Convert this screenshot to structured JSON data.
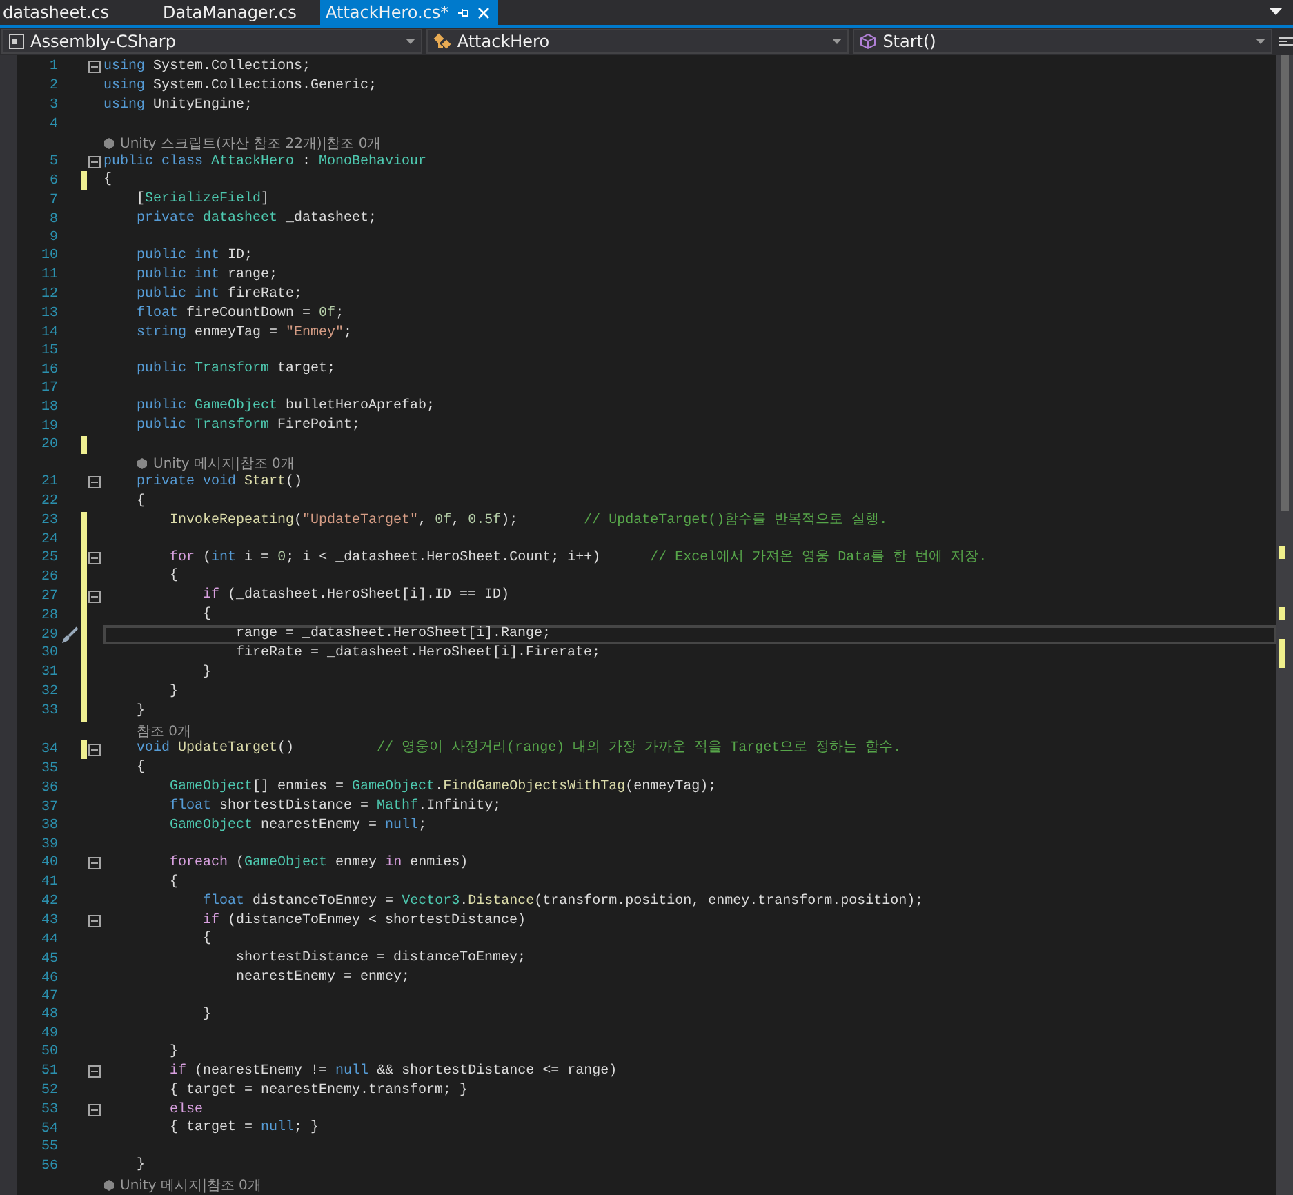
{
  "tabs": [
    {
      "label": "datasheet.cs",
      "selected": false
    },
    {
      "label": "DataManager.cs",
      "selected": false
    },
    {
      "label": "AttackHero.cs*",
      "selected": true
    }
  ],
  "navigation_bar": [
    {
      "kind": "project",
      "text": "Assembly-CSharp"
    },
    {
      "kind": "class",
      "text": "AttackHero"
    },
    {
      "kind": "member",
      "text": "Start()"
    }
  ],
  "editor": {
    "lines": [
      {
        "kind": "code",
        "number": "1",
        "fold": true,
        "changed": false,
        "current": false,
        "tokens": [
          {
            "kind": "kw",
            "text": "using"
          },
          {
            "kind": "p",
            "text": " System.Collections;"
          }
        ]
      },
      {
        "kind": "code",
        "number": "2",
        "fold": false,
        "changed": false,
        "current": false,
        "tokens": [
          {
            "kind": "kw",
            "text": "using"
          },
          {
            "kind": "p",
            "text": " System.Collections.Generic;"
          }
        ]
      },
      {
        "kind": "code",
        "number": "3",
        "fold": false,
        "changed": false,
        "current": false,
        "tokens": [
          {
            "kind": "kw",
            "text": "using"
          },
          {
            "kind": "p",
            "text": " UnityEngine;"
          }
        ]
      },
      {
        "kind": "code",
        "number": "4",
        "fold": false,
        "changed": false,
        "current": false
      },
      {
        "kind": "lens",
        "icon": true,
        "text": "Unity 스크립트(자산 참조 22개)|참조 0개"
      },
      {
        "kind": "code",
        "number": "5",
        "fold": true,
        "changed": false,
        "current": false,
        "tokens": [
          {
            "kind": "kw",
            "text": "public class"
          },
          {
            "kind": "type",
            "text": " AttackHero"
          },
          {
            "kind": "p",
            "text": " : "
          },
          {
            "kind": "type",
            "text": "MonoBehaviour"
          }
        ]
      },
      {
        "kind": "code",
        "number": "6",
        "fold": false,
        "changed": true,
        "current": false,
        "tokens": [
          {
            "kind": "p",
            "text": "{"
          }
        ]
      },
      {
        "kind": "code",
        "number": "7",
        "fold": false,
        "changed": false,
        "current": false,
        "tokens": [
          {
            "kind": "p",
            "text": "    ["
          },
          {
            "kind": "type",
            "text": "SerializeField"
          },
          {
            "kind": "p",
            "text": "]"
          }
        ]
      },
      {
        "kind": "code",
        "number": "8",
        "fold": false,
        "changed": false,
        "current": false,
        "tokens": [
          {
            "kind": "kw",
            "text": "    private"
          },
          {
            "kind": "type",
            "text": " datasheet"
          },
          {
            "kind": "p",
            "text": " _datasheet;"
          }
        ]
      },
      {
        "kind": "code",
        "number": "9",
        "fold": false,
        "changed": false,
        "current": false
      },
      {
        "kind": "code",
        "number": "10",
        "fold": false,
        "changed": false,
        "current": false,
        "tokens": [
          {
            "kind": "kw",
            "text": "    public int"
          },
          {
            "kind": "p",
            "text": " ID;"
          }
        ]
      },
      {
        "kind": "code",
        "number": "11",
        "fold": false,
        "changed": false,
        "current": false,
        "tokens": [
          {
            "kind": "kw",
            "text": "    public int"
          },
          {
            "kind": "p",
            "text": " range;"
          }
        ]
      },
      {
        "kind": "code",
        "number": "12",
        "fold": false,
        "changed": false,
        "current": false,
        "tokens": [
          {
            "kind": "kw",
            "text": "    public int"
          },
          {
            "kind": "p",
            "text": " fireRate;"
          }
        ]
      },
      {
        "kind": "code",
        "number": "13",
        "fold": false,
        "changed": false,
        "current": false,
        "tokens": [
          {
            "kind": "kw",
            "text": "    float"
          },
          {
            "kind": "p",
            "text": " fireCountDown = "
          },
          {
            "kind": "num",
            "text": "0f"
          },
          {
            "kind": "p",
            "text": ";"
          }
        ]
      },
      {
        "kind": "code",
        "number": "14",
        "fold": false,
        "changed": false,
        "current": false,
        "tokens": [
          {
            "kind": "kw",
            "text": "    string"
          },
          {
            "kind": "p",
            "text": " enmeyTag = "
          },
          {
            "kind": "str",
            "text": "\"Enmey\""
          },
          {
            "kind": "p",
            "text": ";"
          }
        ]
      },
      {
        "kind": "code",
        "number": "15",
        "fold": false,
        "changed": false,
        "current": false
      },
      {
        "kind": "code",
        "number": "16",
        "fold": false,
        "changed": false,
        "current": false,
        "tokens": [
          {
            "kind": "kw",
            "text": "    public"
          },
          {
            "kind": "type",
            "text": " Transform"
          },
          {
            "kind": "p",
            "text": " target;"
          }
        ]
      },
      {
        "kind": "code",
        "number": "17",
        "fold": false,
        "changed": false,
        "current": false
      },
      {
        "kind": "code",
        "number": "18",
        "fold": false,
        "changed": false,
        "current": false,
        "tokens": [
          {
            "kind": "kw",
            "text": "    public"
          },
          {
            "kind": "type",
            "text": " GameObject"
          },
          {
            "kind": "p",
            "text": " bulletHeroAprefab;"
          }
        ]
      },
      {
        "kind": "code",
        "number": "19",
        "fold": false,
        "changed": false,
        "current": false,
        "tokens": [
          {
            "kind": "kw",
            "text": "    public"
          },
          {
            "kind": "type",
            "text": " Transform"
          },
          {
            "kind": "p",
            "text": " FirePoint;"
          }
        ]
      },
      {
        "kind": "code",
        "number": "20",
        "fold": false,
        "changed": true,
        "current": false
      },
      {
        "kind": "lens",
        "icon": true,
        "text": "Unity 메시지|참조 0개"
      },
      {
        "kind": "code",
        "number": "21",
        "fold": true,
        "changed": false,
        "current": false,
        "tokens": [
          {
            "kind": "kw",
            "text": "    private void"
          },
          {
            "kind": "fn",
            "text": " Start"
          },
          {
            "kind": "p",
            "text": "()"
          }
        ]
      },
      {
        "kind": "code",
        "number": "22",
        "fold": false,
        "changed": false,
        "current": false,
        "tokens": [
          {
            "kind": "p",
            "text": "    {"
          }
        ]
      },
      {
        "kind": "code",
        "number": "23",
        "fold": false,
        "changed": true,
        "current": false,
        "tokens": [
          {
            "kind": "fn",
            "text": "        InvokeRepeating"
          },
          {
            "kind": "p",
            "text": "("
          },
          {
            "kind": "str",
            "text": "\"UpdateTarget\""
          },
          {
            "kind": "p",
            "text": ", "
          },
          {
            "kind": "num",
            "text": "0f"
          },
          {
            "kind": "p",
            "text": ", "
          },
          {
            "kind": "num",
            "text": "0.5f"
          },
          {
            "kind": "p",
            "text": ");"
          },
          {
            "kind": "cm",
            "text": "        // UpdateTarget()함수를 반복적으로 실행."
          }
        ]
      },
      {
        "kind": "code",
        "number": "24",
        "fold": false,
        "changed": true,
        "current": false
      },
      {
        "kind": "code",
        "number": "25",
        "fold": true,
        "changed": true,
        "current": false,
        "tokens": [
          {
            "kind": "ctl",
            "text": "        for"
          },
          {
            "kind": "p",
            "text": " ("
          },
          {
            "kind": "kw",
            "text": "int"
          },
          {
            "kind": "p",
            "text": " i = "
          },
          {
            "kind": "num",
            "text": "0"
          },
          {
            "kind": "p",
            "text": "; i < _datasheet.HeroSheet.Count; i++)"
          },
          {
            "kind": "cm",
            "text": "      // Excel에서 가져온 영웅 Data를 한 번에 저장."
          }
        ]
      },
      {
        "kind": "code",
        "number": "26",
        "fold": false,
        "changed": true,
        "current": false,
        "tokens": [
          {
            "kind": "p",
            "text": "        {"
          }
        ]
      },
      {
        "kind": "code",
        "number": "27",
        "fold": true,
        "changed": true,
        "current": false,
        "tokens": [
          {
            "kind": "ctl",
            "text": "            if"
          },
          {
            "kind": "p",
            "text": " (_datasheet.HeroSheet[i].ID == ID)"
          }
        ]
      },
      {
        "kind": "code",
        "number": "28",
        "fold": false,
        "changed": true,
        "current": false,
        "tokens": [
          {
            "kind": "p",
            "text": "            {"
          }
        ]
      },
      {
        "kind": "code",
        "number": "29",
        "fold": false,
        "changed": true,
        "current": true,
        "tokens": [
          {
            "kind": "p",
            "text": "                range = _datasheet.HeroSheet[i].Range;"
          }
        ]
      },
      {
        "kind": "code",
        "number": "30",
        "fold": false,
        "changed": true,
        "current": false,
        "tokens": [
          {
            "kind": "p",
            "text": "                fireRate = _datasheet.HeroSheet[i].Firerate;"
          }
        ]
      },
      {
        "kind": "code",
        "number": "31",
        "fold": false,
        "changed": true,
        "current": false,
        "tokens": [
          {
            "kind": "p",
            "text": "            }"
          }
        ]
      },
      {
        "kind": "code",
        "number": "32",
        "fold": false,
        "changed": true,
        "current": false,
        "tokens": [
          {
            "kind": "p",
            "text": "        }"
          }
        ]
      },
      {
        "kind": "code",
        "number": "33",
        "fold": false,
        "changed": true,
        "current": false,
        "tokens": [
          {
            "kind": "p",
            "text": "    }"
          }
        ]
      },
      {
        "kind": "lens",
        "icon": false,
        "text": "참조 0개"
      },
      {
        "kind": "code",
        "number": "34",
        "fold": true,
        "changed": true,
        "current": false,
        "tokens": [
          {
            "kind": "kw",
            "text": "    void"
          },
          {
            "kind": "fn",
            "text": " UpdateTarget"
          },
          {
            "kind": "p",
            "text": "()"
          },
          {
            "kind": "cm",
            "text": "          // 영웅이 사정거리(range) 내의 가장 가까운 적을 Target으로 정하는 함수."
          }
        ]
      },
      {
        "kind": "code",
        "number": "35",
        "fold": false,
        "changed": false,
        "current": false,
        "tokens": [
          {
            "kind": "p",
            "text": "    {"
          }
        ]
      },
      {
        "kind": "code",
        "number": "36",
        "fold": false,
        "changed": false,
        "current": false,
        "tokens": [
          {
            "kind": "type",
            "text": "        GameObject"
          },
          {
            "kind": "p",
            "text": "[] enmies = "
          },
          {
            "kind": "type",
            "text": "GameObject"
          },
          {
            "kind": "p",
            "text": "."
          },
          {
            "kind": "fn",
            "text": "FindGameObjectsWithTag"
          },
          {
            "kind": "p",
            "text": "(enmeyTag);"
          }
        ]
      },
      {
        "kind": "code",
        "number": "37",
        "fold": false,
        "changed": false,
        "current": false,
        "tokens": [
          {
            "kind": "kw",
            "text": "        float"
          },
          {
            "kind": "p",
            "text": " shortestDistance = "
          },
          {
            "kind": "type",
            "text": "Mathf"
          },
          {
            "kind": "p",
            "text": ".Infinity;"
          }
        ]
      },
      {
        "kind": "code",
        "number": "38",
        "fold": false,
        "changed": false,
        "current": false,
        "tokens": [
          {
            "kind": "type",
            "text": "        GameObject"
          },
          {
            "kind": "p",
            "text": " nearestEnemy = "
          },
          {
            "kind": "kw",
            "text": "null"
          },
          {
            "kind": "p",
            "text": ";"
          }
        ]
      },
      {
        "kind": "code",
        "number": "39",
        "fold": false,
        "changed": false,
        "current": false
      },
      {
        "kind": "code",
        "number": "40",
        "fold": true,
        "changed": false,
        "current": false,
        "tokens": [
          {
            "kind": "ctl",
            "text": "        foreach"
          },
          {
            "kind": "p",
            "text": " ("
          },
          {
            "kind": "type",
            "text": "GameObject"
          },
          {
            "kind": "p",
            "text": " enmey "
          },
          {
            "kind": "ctl",
            "text": "in"
          },
          {
            "kind": "p",
            "text": " enmies)"
          }
        ]
      },
      {
        "kind": "code",
        "number": "41",
        "fold": false,
        "changed": false,
        "current": false,
        "tokens": [
          {
            "kind": "p",
            "text": "        {"
          }
        ]
      },
      {
        "kind": "code",
        "number": "42",
        "fold": false,
        "changed": false,
        "current": false,
        "tokens": [
          {
            "kind": "kw",
            "text": "            float"
          },
          {
            "kind": "p",
            "text": " distanceToEnmey = "
          },
          {
            "kind": "type",
            "text": "Vector3"
          },
          {
            "kind": "p",
            "text": "."
          },
          {
            "kind": "fn",
            "text": "Distance"
          },
          {
            "kind": "p",
            "text": "(transform.position, enmey.transform.position);"
          }
        ]
      },
      {
        "kind": "code",
        "number": "43",
        "fold": true,
        "changed": false,
        "current": false,
        "tokens": [
          {
            "kind": "ctl",
            "text": "            if"
          },
          {
            "kind": "p",
            "text": " (distanceToEnmey < shortestDistance)"
          }
        ]
      },
      {
        "kind": "code",
        "number": "44",
        "fold": false,
        "changed": false,
        "current": false,
        "tokens": [
          {
            "kind": "p",
            "text": "            {"
          }
        ]
      },
      {
        "kind": "code",
        "number": "45",
        "fold": false,
        "changed": false,
        "current": false,
        "tokens": [
          {
            "kind": "p",
            "text": "                shortestDistance = distanceToEnmey;"
          }
        ]
      },
      {
        "kind": "code",
        "number": "46",
        "fold": false,
        "changed": false,
        "current": false,
        "tokens": [
          {
            "kind": "p",
            "text": "                nearestEnemy = enmey;"
          }
        ]
      },
      {
        "kind": "code",
        "number": "47",
        "fold": false,
        "changed": false,
        "current": false
      },
      {
        "kind": "code",
        "number": "48",
        "fold": false,
        "changed": false,
        "current": false,
        "tokens": [
          {
            "kind": "p",
            "text": "            }"
          }
        ]
      },
      {
        "kind": "code",
        "number": "49",
        "fold": false,
        "changed": false,
        "current": false
      },
      {
        "kind": "code",
        "number": "50",
        "fold": false,
        "changed": false,
        "current": false,
        "tokens": [
          {
            "kind": "p",
            "text": "        }"
          }
        ]
      },
      {
        "kind": "code",
        "number": "51",
        "fold": true,
        "changed": false,
        "current": false,
        "tokens": [
          {
            "kind": "ctl",
            "text": "        if"
          },
          {
            "kind": "p",
            "text": " (nearestEnemy != "
          },
          {
            "kind": "kw",
            "text": "null"
          },
          {
            "kind": "p",
            "text": " && shortestDistance <= range)"
          }
        ]
      },
      {
        "kind": "code",
        "number": "52",
        "fold": false,
        "changed": false,
        "current": false,
        "tokens": [
          {
            "kind": "p",
            "text": "        { target = nearestEnemy.transform; }"
          }
        ]
      },
      {
        "kind": "code",
        "number": "53",
        "fold": true,
        "changed": false,
        "current": false,
        "tokens": [
          {
            "kind": "ctl",
            "text": "        else"
          }
        ]
      },
      {
        "kind": "code",
        "number": "54",
        "fold": false,
        "changed": false,
        "current": false,
        "tokens": [
          {
            "kind": "p",
            "text": "        { target = "
          },
          {
            "kind": "kw",
            "text": "null"
          },
          {
            "kind": "p",
            "text": "; }"
          }
        ]
      },
      {
        "kind": "code",
        "number": "55",
        "fold": false,
        "changed": false,
        "current": false
      },
      {
        "kind": "code",
        "number": "56",
        "fold": false,
        "changed": false,
        "current": false,
        "tokens": [
          {
            "kind": "p",
            "text": "    }"
          }
        ]
      },
      {
        "kind": "lens",
        "icon": true,
        "text": "Unity 메시지|참조 0개"
      }
    ]
  }
}
